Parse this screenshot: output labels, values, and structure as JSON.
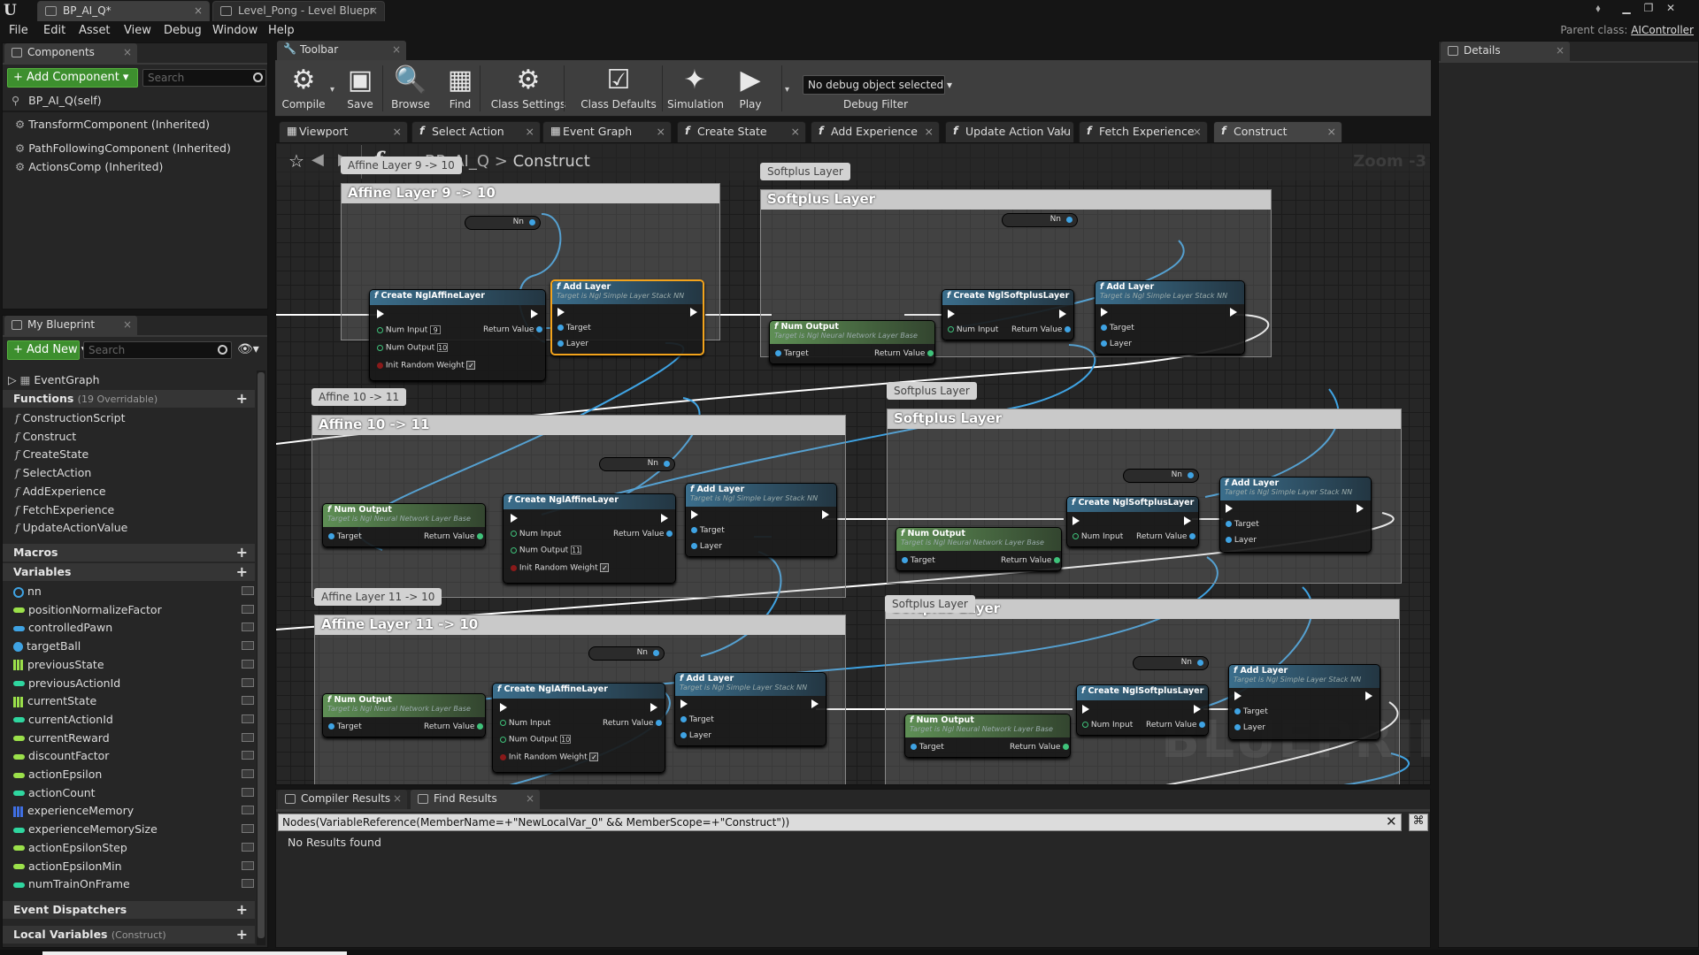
{
  "window": {
    "tabs": [
      {
        "label": "BP_AI_Q*",
        "active": true
      },
      {
        "label": "Level_Pong - Level Bluepr",
        "active": false
      }
    ],
    "parent_class_label": "Parent class:",
    "parent_class_value": "AIController"
  },
  "menu": [
    "File",
    "Edit",
    "Asset",
    "View",
    "Debug",
    "Window",
    "Help"
  ],
  "components_panel": {
    "title": "Components",
    "add_button": "+ Add Component ▾",
    "search_placeholder": "Search",
    "self_item": "BP_AI_Q(self)",
    "items": [
      "TransformComponent (Inherited)",
      "PathFollowingComponent (Inherited)",
      "ActionsComp (Inherited)"
    ]
  },
  "my_blueprint": {
    "title": "My Blueprint",
    "add_button": "+ Add New ▾",
    "search_placeholder": "Search",
    "event_graph": "EventGraph",
    "functions_label": "Functions",
    "functions_sub": "(19 Overridable)",
    "functions": [
      "ConstructionScript",
      "Construct",
      "CreateState",
      "SelectAction",
      "AddExperience",
      "FetchExperience",
      "UpdateActionValue"
    ],
    "macros_label": "Macros",
    "variables_label": "Variables",
    "variables": [
      {
        "name": "nn",
        "color": "#3fa3e3",
        "kind": "ring"
      },
      {
        "name": "positionNormalizeFactor",
        "color": "#9be04a",
        "kind": "pill"
      },
      {
        "name": "controlledPawn",
        "color": "#3fa3e3",
        "kind": "pill"
      },
      {
        "name": "targetBall",
        "color": "#3fa3e3",
        "kind": "dot"
      },
      {
        "name": "previousState",
        "color": "#9be04a",
        "kind": "grid"
      },
      {
        "name": "previousActionId",
        "color": "#2fd69f",
        "kind": "pill"
      },
      {
        "name": "currentState",
        "color": "#9be04a",
        "kind": "grid"
      },
      {
        "name": "currentActionId",
        "color": "#2fd69f",
        "kind": "pill"
      },
      {
        "name": "currentReward",
        "color": "#9be04a",
        "kind": "pill"
      },
      {
        "name": "discountFactor",
        "color": "#9be04a",
        "kind": "pill"
      },
      {
        "name": "actionEpsilon",
        "color": "#9be04a",
        "kind": "pill"
      },
      {
        "name": "actionCount",
        "color": "#2fd69f",
        "kind": "pill"
      },
      {
        "name": "experienceMemory",
        "color": "#3f6fe3",
        "kind": "grid"
      },
      {
        "name": "experienceMemorySize",
        "color": "#2fd69f",
        "kind": "pill"
      },
      {
        "name": "actionEpsilonStep",
        "color": "#9be04a",
        "kind": "pill"
      },
      {
        "name": "actionEpsilonMin",
        "color": "#9be04a",
        "kind": "pill"
      },
      {
        "name": "numTrainOnFrame",
        "color": "#2fd69f",
        "kind": "pill"
      }
    ],
    "event_dispatchers_label": "Event Dispatchers",
    "local_variables_label": "Local Variables",
    "local_variables_sub": "(Construct)"
  },
  "toolbar": {
    "tab_title": "Toolbar",
    "buttons": [
      {
        "label": "Compile",
        "icon": "compile-icon",
        "glyph": "⚙"
      },
      {
        "label": "Save",
        "icon": "save-icon",
        "glyph": "▣"
      },
      {
        "label": "Browse",
        "icon": "browse-icon",
        "glyph": "🔍"
      },
      {
        "label": "Find",
        "icon": "find-icon",
        "glyph": "▦"
      },
      {
        "label": "Class Settings",
        "icon": "class-settings-icon",
        "glyph": "⚙"
      },
      {
        "label": "Class Defaults",
        "icon": "class-defaults-icon",
        "glyph": "☑"
      },
      {
        "label": "Simulation",
        "icon": "simulation-icon",
        "glyph": "✦"
      },
      {
        "label": "Play",
        "icon": "play-icon",
        "glyph": "▶"
      }
    ],
    "debug_select": "No debug object selected ▾",
    "debug_filter": "Debug Filter"
  },
  "graph_tabs": [
    {
      "label": "Viewport",
      "fn": false
    },
    {
      "label": "Select Action",
      "fn": true
    },
    {
      "label": "Event Graph",
      "fn": false
    },
    {
      "label": "Create State",
      "fn": true
    },
    {
      "label": "Add Experience",
      "fn": true
    },
    {
      "label": "Update Action Valu",
      "fn": true
    },
    {
      "label": "Fetch Experience",
      "fn": true
    },
    {
      "label": "Construct",
      "fn": true,
      "active": true
    }
  ],
  "breadcrumb": {
    "root": "BP_AI_Q",
    "sep": ">",
    "leaf": "Construct",
    "zoom": "Zoom -3"
  },
  "watermark": "BLUEPRINT",
  "comments": [
    {
      "bubble": "Affine Layer 9 -> 10",
      "header": "Affine Layer 9 -> 10"
    },
    {
      "bubble": "Softplus Layer",
      "header": "Softplus Layer"
    },
    {
      "bubble": "Affine 10 -> 11",
      "header": "Affine 10 -> 11"
    },
    {
      "bubble": "Softplus Layer",
      "header": "Softplus Layer"
    },
    {
      "bubble": "Affine Layer 11 -> 10",
      "header": "Affine Layer 11 -> 10"
    },
    {
      "bubble": "Softplus Layer",
      "header": "Softplus Layer"
    }
  ],
  "nodes": {
    "nn_label": "Nn",
    "affine_title": "Create NglAffineLayer",
    "softplus_title": "Create NglSoftplusLayer",
    "addlayer_title": "Add Layer",
    "addlayer_sub": "Target is Ngl Simple Layer Stack NN",
    "numoutput_title": "Num Output",
    "numoutput_sub": "Target is Ngl Neural Network Layer Base",
    "pin_num_input": "Num Input",
    "pin_num_output": "Num Output",
    "pin_init_random": "Init Random Weight",
    "pin_return": "Return Value",
    "pin_target": "Target",
    "pin_layer": "Layer",
    "affine1_input": "9",
    "affine1_output": "10",
    "affine2_output": "11",
    "affine3_output": "10",
    "check": "✓"
  },
  "lower_panel": {
    "tabs": [
      "Compiler Results",
      "Find Results"
    ],
    "query": "Nodes(VariableReference(MemberName=+\"NewLocalVar_0\" && MemberScope=+\"Construct\"))",
    "result": "No Results found"
  },
  "details_panel": {
    "title": "Details"
  }
}
